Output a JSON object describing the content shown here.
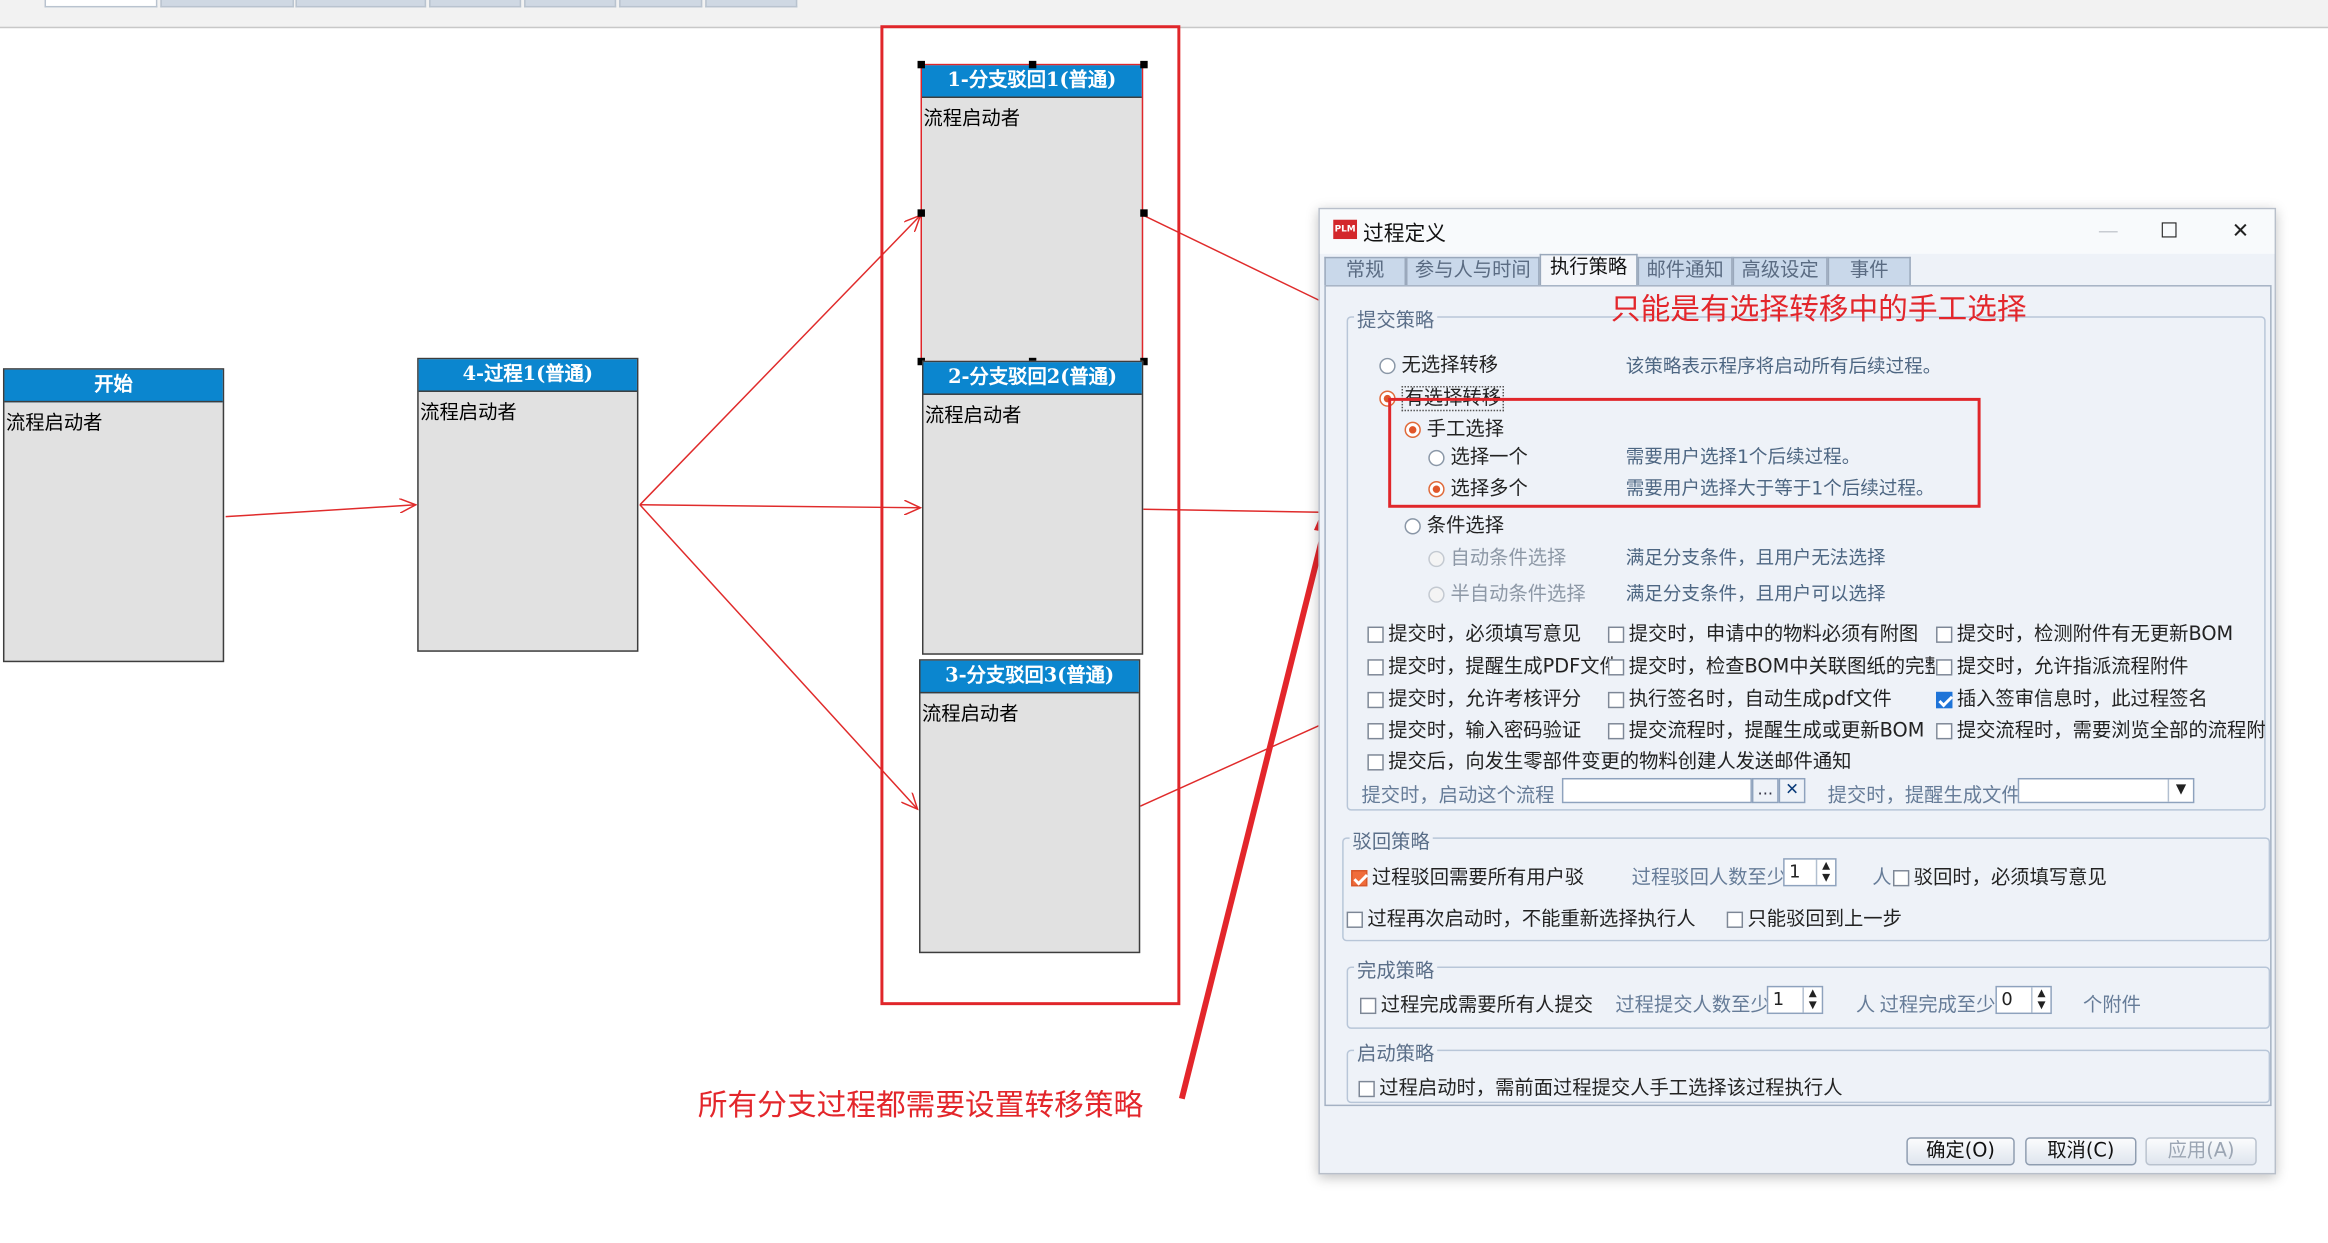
{
  "diagram": {
    "nodes": [
      {
        "title": "开始",
        "body": "流程启动者"
      },
      {
        "title": "4-过程1(普通)",
        "body": "流程启动者"
      },
      {
        "title": "1-分支驳回1(普通)",
        "body": "流程启动者"
      },
      {
        "title": "2-分支驳回2(普通)",
        "body": "流程启动者"
      },
      {
        "title": "3-分支驳回3(普通)",
        "body": "流程启动者"
      }
    ]
  },
  "annotations": {
    "manual_only": "只能是有选择转移中的手工选择",
    "all_branches": "所有分支过程都需要设置转移策略"
  },
  "dialog": {
    "logo": "PLM",
    "title": "过程定义",
    "window_buttons": {
      "minimize": "—",
      "maximize": "☐",
      "close": "✕"
    },
    "tabs": [
      "常规",
      "参与人与时间",
      "执行策略",
      "邮件通知",
      "高级设定",
      "事件"
    ],
    "active_tab": "执行策略",
    "submit_policy": {
      "label": "提交策略",
      "no_select": "无选择转移",
      "no_select_desc": "该策略表示程序将启动所有后续过程。",
      "with_select": "有选择转移",
      "manual": "手工选择",
      "select_one": "选择一个",
      "select_one_desc": "需要用户选择1个后续过程。",
      "select_many": "选择多个",
      "select_many_desc": "需要用户选择大于等于1个后续过程。",
      "condition": "条件选择",
      "auto_condition": "自动条件选择",
      "auto_condition_desc": "满足分支条件，且用户无法选择",
      "semi_auto": "半自动条件选择",
      "semi_auto_desc": "满足分支条件，且用户可以选择",
      "options": [
        {
          "label": "提交时，必须填写意见",
          "checked": false
        },
        {
          "label": "提交时，申请中的物料必须有附图",
          "checked": false
        },
        {
          "label": "提交时，检测附件有无更新BOM",
          "checked": false
        },
        {
          "label": "提交时，提醒生成PDF文件",
          "checked": false
        },
        {
          "label": "提交时，检查BOM中关联图纸的完整",
          "checked": false
        },
        {
          "label": "提交时，允许指派流程附件",
          "checked": false
        },
        {
          "label": "提交时，允许考核评分",
          "checked": false
        },
        {
          "label": "执行签名时，自动生成pdf文件",
          "checked": false
        },
        {
          "label": "插入签审信息时，此过程签名",
          "checked": true
        },
        {
          "label": "提交时，输入密码验证",
          "checked": false
        },
        {
          "label": "提交流程时，提醒生成或更新BOM",
          "checked": false
        },
        {
          "label": "提交流程时，需要浏览全部的流程附",
          "checked": false
        },
        {
          "label": "提交后，向发生零部件变更的物料创建人发送邮件通知",
          "checked": false
        }
      ],
      "start_flow_label": "提交时，启动这个流程",
      "browse": "...",
      "clear": "✕",
      "remind_file_label": "提交时，提醒生成文件"
    },
    "reject_policy": {
      "label": "驳回策略",
      "all_users": "过程驳回需要所有用户驳",
      "count_label": "过程驳回人数至少",
      "count_value": "1",
      "unit": "人",
      "must_comment": "驳回时，必须填写意见",
      "no_reselect": "过程再次启动时，不能重新选择执行人",
      "only_prev": "只能驳回到上一步"
    },
    "complete_policy": {
      "label": "完成策略",
      "all_submit": "过程完成需要所有人提交",
      "submit_count_label": "过程提交人数至少",
      "submit_count_value": "1",
      "unit": "人",
      "attach_label": "过程完成至少",
      "attach_value": "0",
      "attach_unit": "个附件"
    },
    "start_policy": {
      "label": "启动策略",
      "manual_pick": "过程启动时，需前面过程提交人手工选择该过程执行人"
    },
    "buttons": {
      "ok": "确定(O)",
      "cancel": "取消(C)",
      "apply": "应用(A)"
    }
  }
}
